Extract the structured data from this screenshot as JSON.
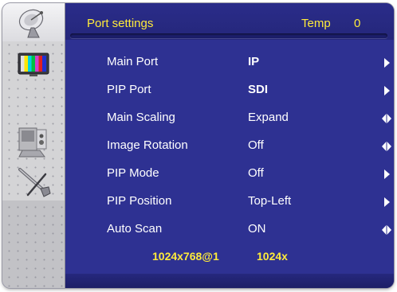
{
  "sidebar": {
    "items": [
      {
        "icon": "satellite-dish-icon",
        "active": true
      },
      {
        "icon": "test-pattern-monitor-icon",
        "active": false
      },
      {
        "icon": "monitor-speaker-icon",
        "active": false
      },
      {
        "icon": "tools-icon",
        "active": false
      }
    ]
  },
  "header": {
    "title": "Port settings",
    "temp_label": "Temp",
    "temp_value": "0"
  },
  "settings": [
    {
      "label": "Main Port",
      "value": "IP",
      "arrow": "right"
    },
    {
      "label": "PIP Port",
      "value": "SDI",
      "arrow": "right"
    },
    {
      "label": "Main Scaling",
      "value": "Expand",
      "arrow": "both"
    },
    {
      "label": "Image Rotation",
      "value": "Off",
      "arrow": "both"
    },
    {
      "label": "PIP Mode",
      "value": "Off",
      "arrow": "right"
    },
    {
      "label": "PIP Position",
      "value": "Top-Left",
      "arrow": "right"
    },
    {
      "label": "Auto Scan",
      "value": "ON",
      "arrow": "both"
    }
  ],
  "status": {
    "main_resolution": "1024x768@1",
    "pip_resolution": "1024x"
  },
  "colors": {
    "panel_bg": "#2e3192",
    "header_text": "#ffeb3b",
    "item_text": "#ffffff",
    "arrow": "#ffffff"
  }
}
